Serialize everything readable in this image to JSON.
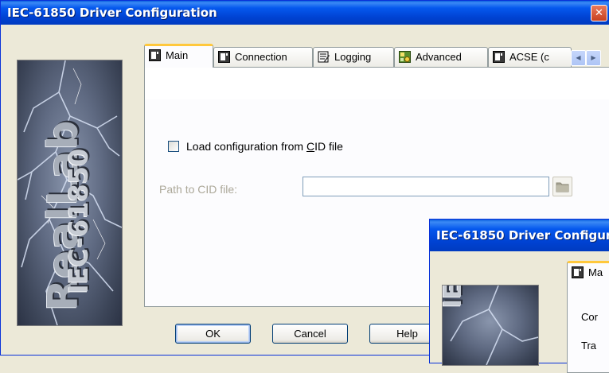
{
  "main_window": {
    "title": "IEC-61850 Driver Configuration",
    "close_glyph": "✕",
    "logo": {
      "top_text": "RealLab",
      "bottom_text": "IEC-61850"
    },
    "tabs": [
      {
        "label": "Main",
        "icon": "driver-icon",
        "active": true
      },
      {
        "label": "Connection",
        "icon": "driver-icon",
        "active": false
      },
      {
        "label": "Logging",
        "icon": "notepad-icon",
        "active": false
      },
      {
        "label": "Advanced",
        "icon": "advanced-icon",
        "active": false
      },
      {
        "label": "ACSE (c",
        "icon": "driver-icon",
        "active": false
      }
    ],
    "tab_scroll": {
      "left": "◀",
      "right": "▶"
    },
    "main_tab": {
      "load_checkbox_label": "Load configuration from CID file",
      "load_checkbox_mnemonic": "C",
      "load_checked": false,
      "path_label": "Path to CID file:",
      "path_value": ""
    },
    "buttons": {
      "ok": "OK",
      "cancel": "Cancel",
      "help": "Help"
    }
  },
  "second_window": {
    "title": "IEC-61850 Driver Configur",
    "tab_label": "Ma",
    "rows": [
      "Cor",
      "Tra"
    ]
  },
  "colors": {
    "title_blue": "#0054e3",
    "close_red": "#d9542c",
    "tab_highlight": "#ffc83c"
  }
}
